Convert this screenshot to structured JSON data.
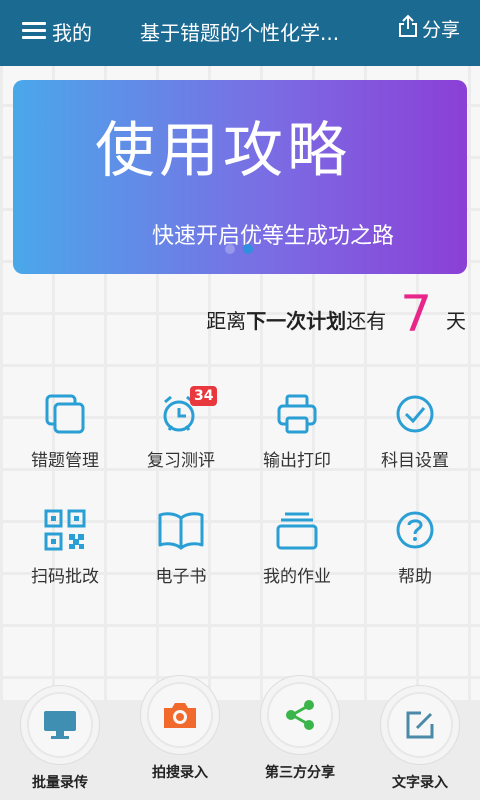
{
  "header": {
    "menu_label": "我的",
    "title": "基于错题的个性化学...",
    "share_label": "分享"
  },
  "banner": {
    "title": "使用攻略",
    "subtitle": "快速开启优等生成功之路"
  },
  "countdown": {
    "prefix": "距离",
    "emphasis": "下一次计划",
    "middle": "还有",
    "days": "7",
    "suffix": "天"
  },
  "grid": {
    "items": [
      {
        "label": "错题管理"
      },
      {
        "label": "复习测评",
        "badge": "34"
      },
      {
        "label": "输出打印"
      },
      {
        "label": "科目设置"
      },
      {
        "label": "扫码批改"
      },
      {
        "label": "电子书"
      },
      {
        "label": "我的作业"
      },
      {
        "label": "帮助"
      }
    ]
  },
  "bottom": {
    "actions": [
      {
        "label": "批量录传",
        "icon": "monitor-icon"
      },
      {
        "label": "拍搜录入",
        "icon": "camera-icon"
      },
      {
        "label": "第三方分享",
        "icon": "share-icon"
      },
      {
        "label": "文字录入",
        "icon": "edit-icon"
      }
    ]
  },
  "colors": {
    "header_bg": "#1b6a91",
    "icon_blue": "#2a9fd6",
    "accent_pink": "#e8268a",
    "camera_orange": "#f26a2b",
    "share_green": "#3bb54a",
    "badge_red": "#e8373d"
  }
}
